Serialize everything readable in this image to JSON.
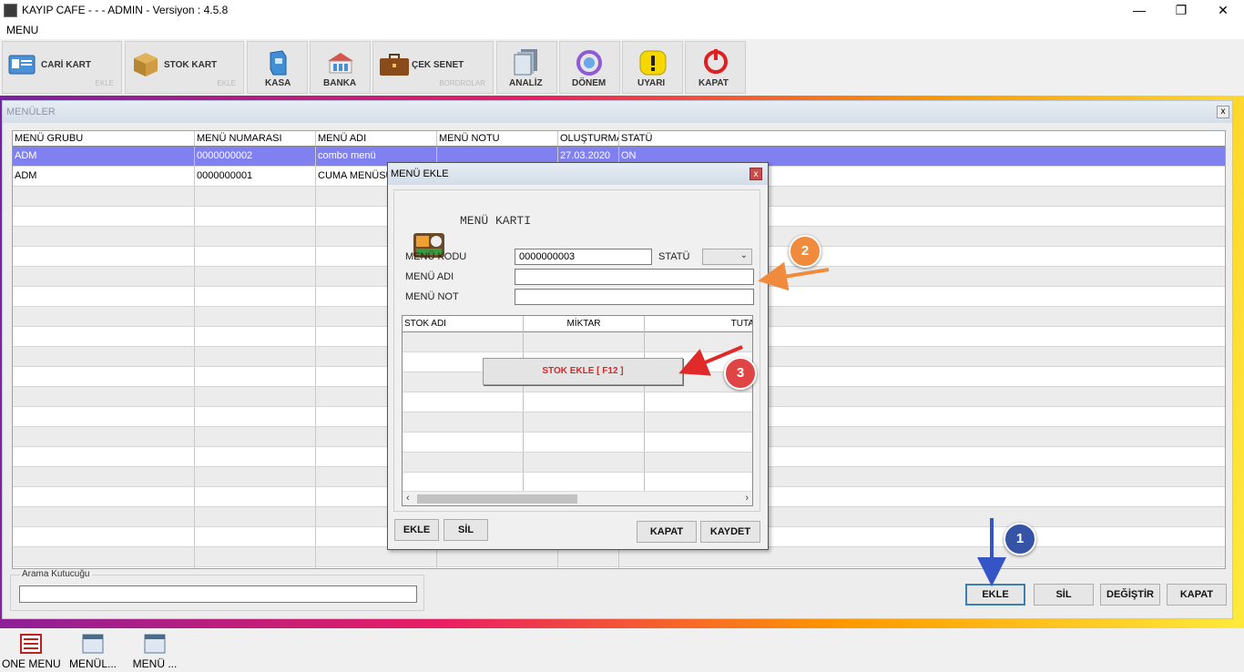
{
  "window": {
    "title": "KAYIP CAFE -  -  - ADMIN -  Versiyon : 4.5.8"
  },
  "menubar": {
    "label": "MENU"
  },
  "toolbar": [
    {
      "label": "CARİ KART",
      "sub": "EKLE"
    },
    {
      "label": "STOK KART",
      "sub": "EKLE"
    },
    {
      "label": "KASA"
    },
    {
      "label": "BANKA"
    },
    {
      "label": "ÇEK SENET",
      "sub": "BORDROLAR"
    },
    {
      "label": "ANALİZ"
    },
    {
      "label": "DÖNEM"
    },
    {
      "label": "UYARI"
    },
    {
      "label": "KAPAT"
    }
  ],
  "main": {
    "title": "MENÜLER",
    "close": "x",
    "columns": [
      "MENÜ GRUBU",
      "MENÜ NUMARASI",
      "MENÜ ADI",
      "MENÜ NOTU",
      "OLUŞTURMA",
      "STATÜ"
    ],
    "rows": [
      [
        "ADM",
        "0000000002",
        "combo menü",
        "",
        "27.03.2020",
        "ON"
      ],
      [
        "ADM",
        "0000000001",
        "CUMA MENÜSÜ",
        "",
        "",
        ""
      ]
    ],
    "search_label": "Arama Kutucuğu",
    "buttons": {
      "add": "EKLE",
      "delete": "SİL",
      "change": "DEĞİŞTİR",
      "close": "KAPAT"
    }
  },
  "dialog": {
    "title": "MENÜ EKLE",
    "close": "x",
    "heading": "MENÜ KARTI",
    "code_label": "MENÜ KODU",
    "code_value": "0000000003",
    "status_label": "STATÜ",
    "name_label": "MENÜ ADI",
    "note_label": "MENÜ NOT",
    "grid_columns": [
      "STOK ADI",
      "MİKTAR",
      "TUTA"
    ],
    "stock_add": "STOK EKLE [ F12 ]",
    "buttons": {
      "add": "EKLE",
      "delete": "SİL",
      "close": "KAPAT",
      "save": "KAYDET"
    }
  },
  "annotations": {
    "one": "1",
    "two": "2",
    "three": "3"
  },
  "taskbar": [
    "ONE MENU",
    "MENÜL...",
    "MENÜ ..."
  ],
  "colors": {
    "selected_row": "#8080f0",
    "stock_button_text": "#d62a2a",
    "badge_1": "#3554a5",
    "badge_2": "#f08a3c",
    "badge_3": "#e04545"
  }
}
